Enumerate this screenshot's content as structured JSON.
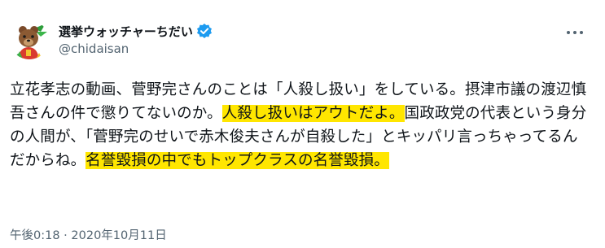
{
  "author": {
    "display_name": "選挙ウォッチャーちだい",
    "handle": "@chidaisan",
    "verified": true
  },
  "tweet": {
    "segments": [
      {
        "text": "立花孝志の動画、菅野完さんのことは「人殺し扱い」をしている。摂津市議の渡辺慎吾さんの件で懲りてないのか。",
        "highlight": false
      },
      {
        "text": "人殺し扱いはアウトだよ。",
        "highlight": true
      },
      {
        "text": "国政政党の代表という身分の人間が、「菅野完のせいで赤木俊夫さんが自殺した」とキッパリ言っちゃってるんだからね。",
        "highlight": false
      },
      {
        "text": "名誉毀損の中でもトップクラスの名誉毀損。",
        "highlight": true
      }
    ],
    "timestamp": "午後0:18 · 2020年10月11日"
  },
  "colors": {
    "highlight": "#ffe600",
    "verified_badge": "#1d9bf0",
    "text_primary": "#0f1419",
    "text_secondary": "#536471"
  },
  "icons": {
    "avatar": "bear-mascot-avatar",
    "verified": "verified-badge-icon",
    "more": "more-options-icon"
  }
}
